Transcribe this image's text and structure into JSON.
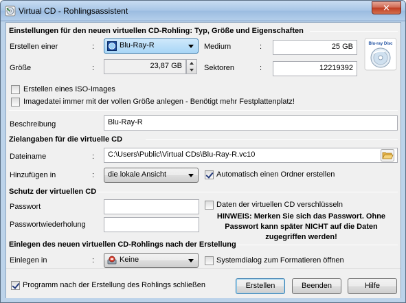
{
  "window": {
    "title": "Virtual CD - Rohlingsassistent",
    "close_label": "✕"
  },
  "settings": {
    "heading": "Einstellungen für den neuen virtuellen CD-Rohling: Typ, Größe und Eigenschaften",
    "create_label": "Erstellen einer",
    "create_value": "Blu-Ray-R",
    "medium_label": "Medium",
    "medium_value": "25 GB",
    "size_label": "Größe",
    "size_value": "23,87 GB",
    "sectors_label": "Sektoren",
    "sectors_value": "12219392",
    "iso_label": "Erstellen eines ISO-Images",
    "iso_checked": false,
    "fullsize_label": "Imagedatei immer mit der vollen Größe anlegen - Benötigt mehr Festplattenplatz!",
    "fullsize_checked": false,
    "colon": ":",
    "disc_icon": "blu-ray-disc-icon",
    "disc_logo_text": "Blu-ray Disc"
  },
  "description": {
    "label": "Beschreibung",
    "value": "Blu-Ray-R"
  },
  "target": {
    "heading": "Zielangaben für die virtuelle CD",
    "filename_label": "Dateiname",
    "filename_value": "C:\\Users\\Public\\Virtual CDs\\Blu-Ray-R.vc10",
    "add_label": "Hinzufügen in",
    "add_value": "die lokale Ansicht",
    "auto_folder_label": "Automatisch einen Ordner erstellen",
    "auto_folder_checked": true
  },
  "protection": {
    "heading": "Schutz der virtuellen CD",
    "password_label": "Passwort",
    "password_value": "",
    "repeat_label": "Passwortwiederholung",
    "repeat_value": "",
    "encrypt_label": "Daten der virtuellen CD verschlüsseln",
    "encrypt_checked": false,
    "warning_line1": "HINWEIS: Merken Sie sich das Passwort. Ohne",
    "warning_line2": "Passwort kann später NICHT auf die Daten",
    "warning_line3": "zugegriffen werden!"
  },
  "insert": {
    "heading": "Einlegen des neuen virtuellen CD-Rohlings nach der Erstellung",
    "label": "Einlegen in",
    "value": "Keine",
    "sysdialog_label": "Systemdialog zum Formatieren öffnen",
    "sysdialog_checked": false
  },
  "footer": {
    "close_after_label": "Programm nach der Erstellung des Rohlings schließen",
    "close_after_checked": true,
    "create_button": "Erstellen",
    "exit_button": "Beenden",
    "help_button": "Hilfe"
  }
}
